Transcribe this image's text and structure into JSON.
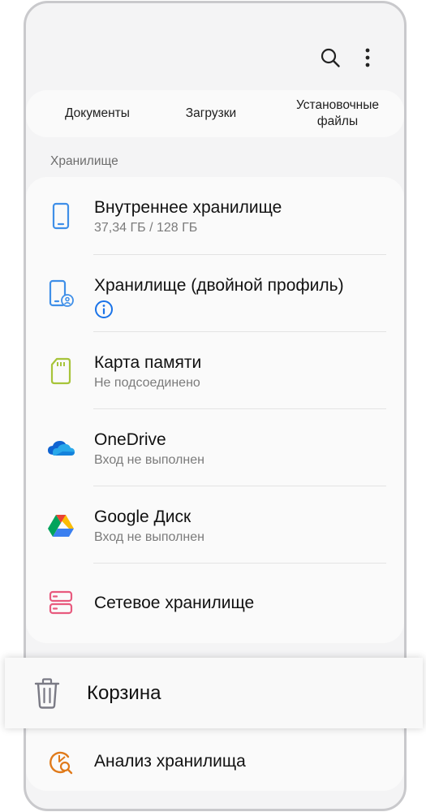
{
  "toolbar": {
    "search_icon": "search-icon",
    "more_icon": "more-vertical-icon"
  },
  "categories": [
    {
      "label": "Документы"
    },
    {
      "label": "Загрузки"
    },
    {
      "label_line1": "Установочные",
      "label_line2": "файлы"
    }
  ],
  "storage": {
    "section_title": "Хранилище",
    "items": [
      {
        "title": "Внутреннее хранилище",
        "subtitle": "37,34 ГБ / 128 ГБ",
        "icon": "phone-icon",
        "color": "#3f8fe8"
      },
      {
        "title": "Хранилище (двойной профиль)",
        "icon": "dual-profile-phone-icon",
        "info_icon": "info-icon",
        "color": "#3f8fe8"
      },
      {
        "title": "Карта памяти",
        "subtitle": "Не подсоединено",
        "icon": "sd-card-icon",
        "color": "#a7c43a"
      },
      {
        "title": "OneDrive",
        "subtitle": "Вход не выполнен",
        "icon": "onedrive-icon",
        "color": "#1e6fd9"
      },
      {
        "title": "Google Диск",
        "subtitle": "Вход не выполнен",
        "icon": "google-drive-icon"
      },
      {
        "title": "Сетевое хранилище",
        "icon": "network-storage-icon",
        "color": "#e85a7e"
      }
    ]
  },
  "trash": {
    "label": "Корзина",
    "icon": "trash-icon",
    "color": "#7a7a85"
  },
  "analysis": {
    "label": "Анализ хранилища",
    "icon": "storage-analysis-icon",
    "color": "#e07a1a"
  }
}
